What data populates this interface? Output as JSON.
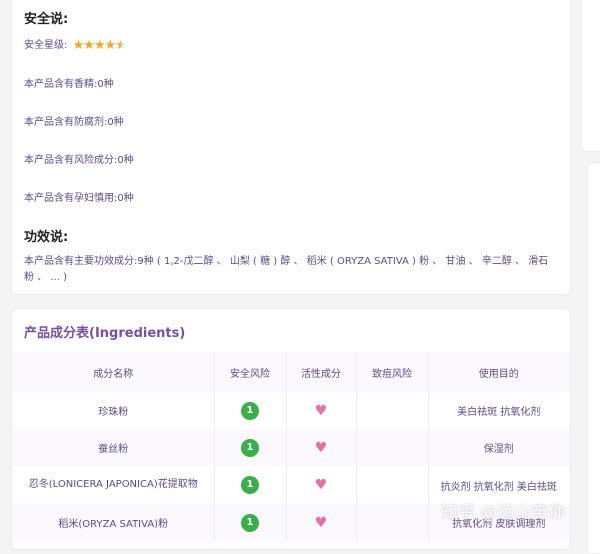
{
  "safety": {
    "heading": "安全说:",
    "rating_label": "安全星级:",
    "rating_value": 4.5,
    "rating_max": 5,
    "rows": [
      {
        "label": "本产品含有香精:",
        "value": "0种"
      },
      {
        "label": "本产品含有防腐剂:",
        "value": "0种"
      },
      {
        "label": "本产品含有风险成分:",
        "value": "0种"
      },
      {
        "label": "本产品含有孕妇慎用:",
        "value": "0种"
      }
    ]
  },
  "efficacy": {
    "heading": "功效说:",
    "text": "本产品含有主要功效成分:9种 ( 1,2-戊二醇 、 山梨 ( 糖 ) 醇 、 稻米 ( ORYZA SATIVA ) 粉 、 甘油 、 辛二醇 、 滑石粉 、 ... )"
  },
  "ingredients": {
    "title": "产品成分表(Ingredients)",
    "columns": [
      "成分名称",
      "安全风险",
      "活性成分",
      "致痘风险",
      "使用目的"
    ],
    "rows": [
      {
        "name": "珍珠粉",
        "risk": "1",
        "active": "heart-icon",
        "acne": "",
        "purpose": "美白祛斑 抗氧化剂"
      },
      {
        "name": "蚕丝粉",
        "risk": "1",
        "active": "heart-icon",
        "acne": "",
        "purpose": "保湿剂"
      },
      {
        "name": "忍冬(LONICERA JAPONICA)花提取物",
        "risk": "1",
        "active": "heart-icon",
        "acne": "",
        "purpose": "抗炎剂 抗氧化剂 美白祛斑"
      },
      {
        "name": "稻米(ORYZA SATIVA)粉",
        "risk": "1",
        "active": "heart-icon",
        "acne": "",
        "purpose": "抗氧化剂 皮肤调理剂"
      }
    ]
  },
  "watermark": "知乎 @远山笑你",
  "colors": {
    "accent": "#7a4fa3",
    "text_purple": "#5f4a8b",
    "star": "#f5a623",
    "risk_green": "#3aae4a",
    "heart_pink": "#e86ea9"
  }
}
